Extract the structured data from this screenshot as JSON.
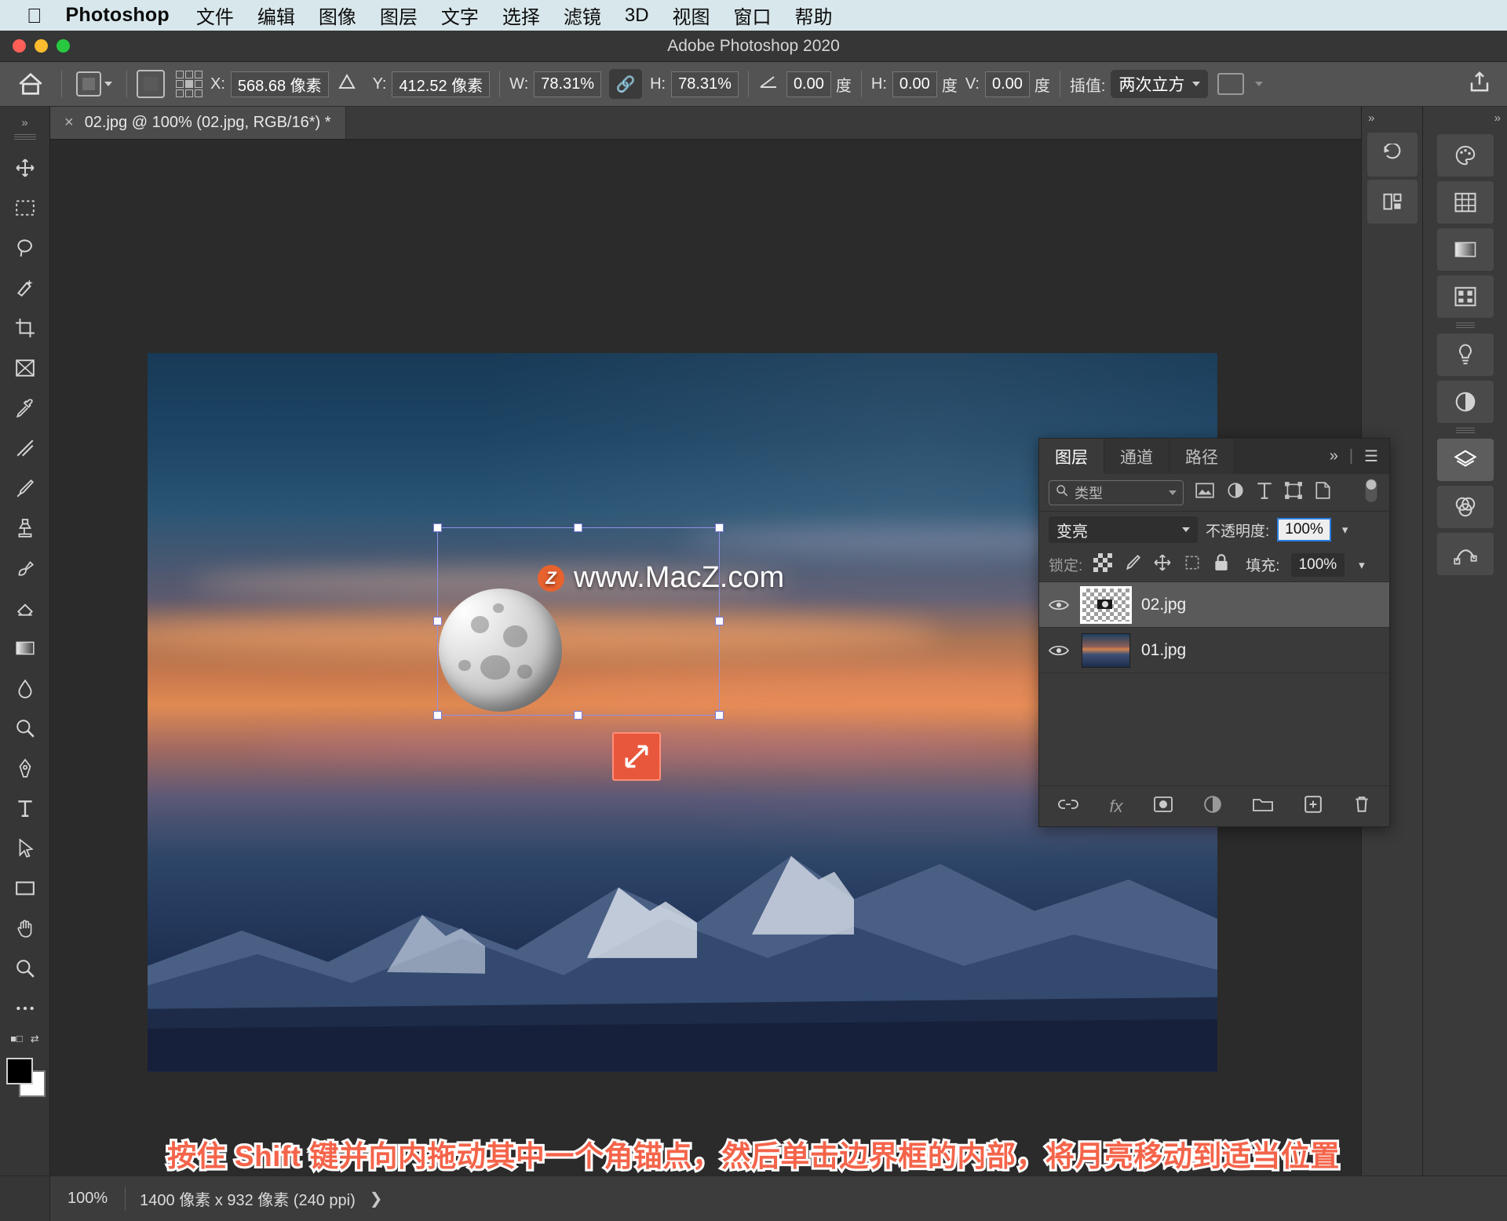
{
  "menubar": {
    "apple_icon": "apple-logo-icon",
    "app_name": "Photoshop",
    "items": [
      "文件",
      "编辑",
      "图像",
      "图层",
      "文字",
      "选择",
      "滤镜",
      "3D",
      "视图",
      "窗口",
      "帮助"
    ]
  },
  "window": {
    "title": "Adobe Photoshop 2020"
  },
  "options_bar": {
    "home_icon": "home-icon",
    "tool_icon": "free-transform-icon",
    "reference_point_label": "reference-point-grid",
    "x_label": "X:",
    "x_value": "568.68 像素",
    "delta_icon": "delta-icon",
    "y_label": "Y:",
    "y_value": "412.52 像素",
    "w_label": "W:",
    "w_value": "78.31%",
    "chain_icon": "link-icon",
    "h_label": "H:",
    "h_value": "78.31%",
    "angle_icon": "angle-icon",
    "angle_value": "0.00",
    "angle_unit": "度",
    "skew_h_label": "H:",
    "skew_h_value": "0.00",
    "skew_h_unit": "度",
    "skew_v_label": "V:",
    "skew_v_value": "0.00",
    "skew_v_unit": "度",
    "interp_label": "插值:",
    "interp_value": "两次立方",
    "share_icon": "share-icon"
  },
  "toolbar": {
    "collapse_icon": "chevron-double-right-icon",
    "tools": [
      {
        "name": "move-tool",
        "icon": "move-icon"
      },
      {
        "name": "rectangular-marquee-tool",
        "icon": "marquee-icon"
      },
      {
        "name": "lasso-tool",
        "icon": "lasso-icon"
      },
      {
        "name": "quick-selection-tool",
        "icon": "quick-select-icon"
      },
      {
        "name": "crop-tool",
        "icon": "crop-icon"
      },
      {
        "name": "frame-tool",
        "icon": "frame-icon"
      },
      {
        "name": "eyedropper-tool",
        "icon": "eyedropper-icon"
      },
      {
        "name": "healing-brush-tool",
        "icon": "healing-icon"
      },
      {
        "name": "brush-tool",
        "icon": "brush-icon"
      },
      {
        "name": "clone-stamp-tool",
        "icon": "stamp-icon"
      },
      {
        "name": "history-brush-tool",
        "icon": "history-brush-icon"
      },
      {
        "name": "eraser-tool",
        "icon": "eraser-icon"
      },
      {
        "name": "gradient-tool",
        "icon": "gradient-icon"
      },
      {
        "name": "blur-tool",
        "icon": "blur-icon"
      },
      {
        "name": "dodge-tool",
        "icon": "dodge-icon"
      },
      {
        "name": "pen-tool",
        "icon": "pen-icon"
      },
      {
        "name": "type-tool",
        "icon": "type-icon"
      },
      {
        "name": "path-selection-tool",
        "icon": "path-select-icon"
      },
      {
        "name": "rectangle-tool",
        "icon": "rectangle-icon"
      },
      {
        "name": "hand-tool",
        "icon": "hand-icon"
      },
      {
        "name": "zoom-tool",
        "icon": "zoom-icon"
      },
      {
        "name": "more-tools",
        "icon": "ellipsis-icon"
      }
    ],
    "foreground_color": "#000000",
    "background_color": "#ffffff"
  },
  "document": {
    "tab_title": "02.jpg @ 100% (02.jpg, RGB/16*) *",
    "close_icon": "close-icon",
    "watermark_text": "www.MacZ.com",
    "watermark_badge": "Z",
    "cursor_icon": "resize-diagonal-icon"
  },
  "layers_panel": {
    "tabs": [
      {
        "label": "图层",
        "active": true
      },
      {
        "label": "通道",
        "active": false
      },
      {
        "label": "路径",
        "active": false
      }
    ],
    "expand_icon": "chevron-double-right-icon",
    "menu_icon": "hamburger-menu-icon",
    "filter": {
      "search_icon": "search-icon",
      "value": "类型",
      "chevron_icon": "chevron-down-icon",
      "icons": [
        "image-filter-icon",
        "adjustment-filter-icon",
        "type-filter-icon",
        "shape-filter-icon",
        "smart-object-filter-icon"
      ],
      "toggle_icon": "filter-toggle-icon"
    },
    "blend_mode": "变亮",
    "opacity_label": "不透明度:",
    "opacity_value": "100%",
    "lock_label": "锁定:",
    "lock_icons": [
      "lock-transparent-icon",
      "lock-image-icon",
      "lock-position-icon",
      "lock-artboard-icon",
      "lock-all-icon"
    ],
    "fill_label": "填充:",
    "fill_value": "100%",
    "layers": [
      {
        "name": "02.jpg",
        "visible": true,
        "selected": true,
        "thumb": "transparent-moon"
      },
      {
        "name": "01.jpg",
        "visible": true,
        "selected": false,
        "thumb": "photo"
      }
    ],
    "bottom_icons": [
      "link-layers-icon",
      "layer-style-fx-icon",
      "layer-mask-icon",
      "adjustment-layer-icon",
      "new-group-icon",
      "new-layer-icon",
      "delete-layer-icon"
    ]
  },
  "right_dock": {
    "icons_narrow": [
      "history-icon",
      "properties-3d-icon"
    ],
    "icons_far": [
      "color-palette-icon",
      "swatches-grid-icon",
      "gradients-icon",
      "patterns-icon",
      "adjustments-bulb-icon",
      "adjustments-half-circle-icon",
      "layers-icon",
      "channels-icon",
      "paths-icon"
    ]
  },
  "caption": {
    "text": "按住 Shift 键并向内拖动其中一个角锚点，然后单击边界框的内部，将月亮移动到适当位置",
    "color": "#f4644a"
  },
  "status_bar": {
    "zoom": "100%",
    "dimensions": "1400 像素 x 932 像素 (240 ppi)",
    "arrow_icon": "chevron-right-icon"
  }
}
